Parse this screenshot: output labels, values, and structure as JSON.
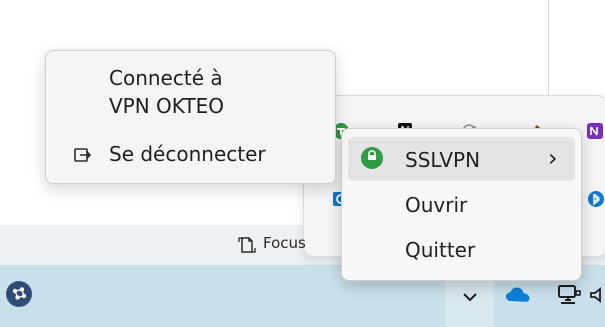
{
  "vpn_menu": {
    "status_line_1": "Connecté à",
    "status_line_2": "VPN OKTEO",
    "disconnect_label": "Se déconnecter"
  },
  "tray_context_menu": {
    "items": [
      {
        "label": "SSLVPN"
      },
      {
        "label": "Ouvrir"
      },
      {
        "label": "Quitter"
      }
    ],
    "chevron": "›"
  },
  "focus": {
    "label": "Focus"
  },
  "icons": {
    "taskbar_left": "network-hub-icon",
    "overflow": "chevron-down-icon",
    "onedrive": "onedrive-icon",
    "network": "network-icon",
    "speaker": "speaker-icon",
    "focus": "focus-icon",
    "disconnect": "disconnect-icon",
    "vpn_shield": "vpn-shield-icon",
    "teams": "teams-icon",
    "notion": "notion-icon",
    "onenote": "onenote-icon",
    "bluetooth": "bluetooth-icon",
    "outlook": "outlook-icon"
  },
  "colors": {
    "taskbar": "#c9e0ea",
    "lower_band": "#eef1f4",
    "flyout": "#f4f5f7",
    "context_menu": "#f8f8f8",
    "highlight": "#e4e4e4",
    "accent_green": "#2f9b43",
    "accent_blue": "#0f78d4",
    "onedrive_blue": "#0b82d9",
    "onenote_purple": "#7a2fbb"
  }
}
